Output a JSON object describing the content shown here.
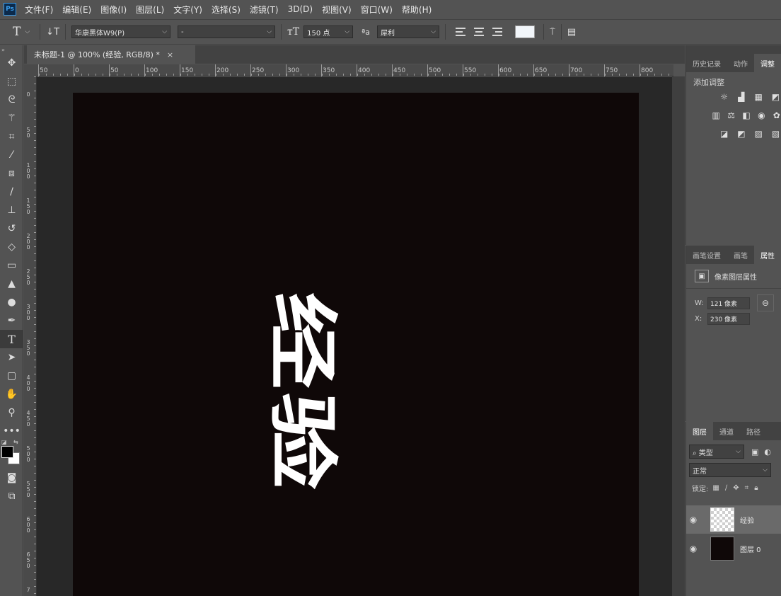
{
  "app": {
    "logo": "Ps"
  },
  "menu": [
    "文件(F)",
    "编辑(E)",
    "图像(I)",
    "图层(L)",
    "文字(Y)",
    "选择(S)",
    "滤镜(T)",
    "3D(D)",
    "视图(V)",
    "窗口(W)",
    "帮助(H)"
  ],
  "options": {
    "font_family": "华康黑体W9(P)",
    "font_style": "-",
    "font_size": "150 点",
    "antialias_label": "ªa",
    "antialias": "犀利",
    "text_color": "#f2f6fa"
  },
  "document": {
    "tab_title": "未标题-1 @ 100% (经验, RGB/8) *",
    "close_glyph": "×",
    "canvas_text": "经验",
    "canvas_bg": "#0f0808"
  },
  "ruler": {
    "h_labels": [
      "50",
      "0",
      "50",
      "100",
      "150",
      "200",
      "250",
      "300",
      "350",
      "400",
      "450",
      "500",
      "550",
      "600",
      "650",
      "700",
      "750",
      "800"
    ],
    "v_labels": [
      [
        "0"
      ],
      [
        "5",
        "0"
      ],
      [
        "1",
        "0",
        "0"
      ],
      [
        "1",
        "5",
        "0"
      ],
      [
        "2",
        "0",
        "0"
      ],
      [
        "2",
        "5",
        "0"
      ],
      [
        "3",
        "0",
        "0"
      ],
      [
        "3",
        "5",
        "0"
      ],
      [
        "4",
        "0",
        "0"
      ],
      [
        "4",
        "5",
        "0"
      ],
      [
        "5",
        "0",
        "0"
      ],
      [
        "5",
        "5",
        "0"
      ],
      [
        "6",
        "0",
        "0"
      ],
      [
        "6",
        "5",
        "0"
      ],
      [
        "7"
      ]
    ]
  },
  "panels": {
    "top_tabs": [
      "历史记录",
      "动作",
      "调整"
    ],
    "adjust_label": "添加调整",
    "mid_tabs": [
      "画笔设置",
      "画笔",
      "属性"
    ],
    "properties_title": "像素图层属性",
    "w_label": "W:",
    "w_value": "121 像素",
    "x_label": "X:",
    "x_value": "230 像素",
    "layer_tabs": [
      "图层",
      "通道",
      "路径"
    ],
    "filter_kind": "类型",
    "blend_mode": "正常",
    "lock_label": "锁定:",
    "layers": [
      {
        "name": "经验"
      },
      {
        "name": "图层 0"
      }
    ]
  },
  "icons": {
    "type_tool": "text-tool-icon",
    "eye": "eye-icon",
    "link": "link-icon"
  }
}
